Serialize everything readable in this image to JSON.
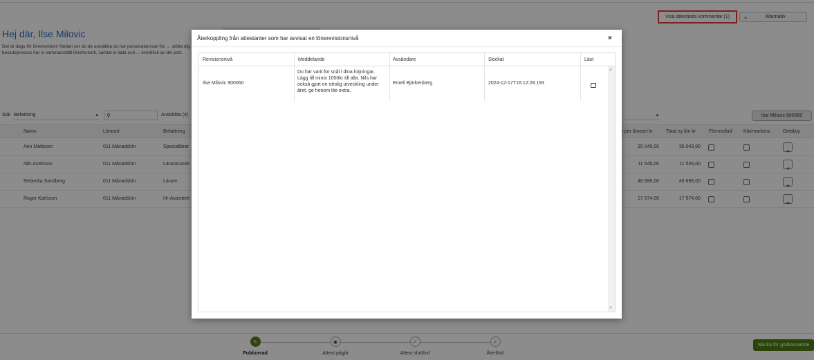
{
  "page": {
    "greeting": "Hej där, Ilse Milovic",
    "intro": "Det är dags för lönerevision! Nedan ser du de anställda du har personalansvar för. ... stötta dig i din beslutsprocess har vi sammanställt lönehistorik, samlat in data och ... överblick av din pott.",
    "show_comment_button": "Visa attestants kommentar (1)",
    "options_button": "Alternativ",
    "search_label": "Sök",
    "position_filter": "Befattning",
    "employees_count": "Anställda (4)",
    "user_button": "Ilse Milovic 900060",
    "send_button": "Skicka för godkännande"
  },
  "table": {
    "headers": {
      "name": "Namn",
      "salary_type": "Löneart",
      "position": "Befattning",
      "new_per_type": "n per löneart kr",
      "total_new": "Total ny lön kr",
      "mediated": "Förmedlad",
      "clarify": "Klarmarkera",
      "detail": "Detaljvy"
    },
    "rows": [
      {
        "name": "Ann Mattsson",
        "salary_type": "011 Månadslön",
        "position": "Speciallärar",
        "new_per_type": "35 049,00",
        "total_new": "35 049,00"
      },
      {
        "name": "Nils Axelsson",
        "salary_type": "011 Månadslön",
        "position": "Lärarassiste",
        "new_per_type": "11 546,00",
        "total_new": "11 546,00"
      },
      {
        "name": "Rebecka Sandberg",
        "salary_type": "011 Månadslön",
        "position": "Lärare",
        "new_per_type": "48 696,00",
        "total_new": "48 696,00"
      },
      {
        "name": "Roger Karlsson",
        "salary_type": "011 Månadslön",
        "position": "Hr-Assistent",
        "new_per_type": "17 574,00",
        "total_new": "17 574,00"
      }
    ]
  },
  "steps": [
    {
      "label": "Publicerad",
      "icon": "pencil-icon"
    },
    {
      "label": "Attest pågår",
      "icon": "eye-icon"
    },
    {
      "label": "Attest slutförd",
      "icon": "check-icon"
    },
    {
      "label": "Återförd",
      "icon": "check-icon"
    }
  ],
  "modal": {
    "title": "Återkoppling från attestanter som har avvisat en lönerevisionsnivå",
    "close": "×",
    "headers": {
      "level": "Revisionsnivå",
      "message": "Meddelande",
      "sender": "Avsändare",
      "sent": "Skickat",
      "read": "Läst"
    },
    "row": {
      "level": "Ilse Milovic 900060",
      "message": "Du har varit för snål i dina höjningar. Lägg till minst 1000kr till alla. Nils har också gjort en otrolig utveckling under året, ge honom lite extra.",
      "sender": "Emeli Björkenberg",
      "sent": "2024-12-17T16:12:28.193"
    }
  },
  "colors": {
    "accent_blue": "#2a6bb5",
    "highlight_red": "#e53935",
    "brand_green": "#4e7c16"
  }
}
